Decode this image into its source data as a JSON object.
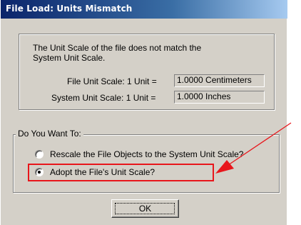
{
  "window": {
    "title": "File Load: Units Mismatch"
  },
  "info": {
    "message_line1": "The Unit Scale of the file does not match the",
    "message_line2": "System Unit Scale.",
    "file_scale_label": "File Unit Scale: 1 Unit =",
    "file_scale_value": "1.0000 Centimeters",
    "system_scale_label": "System Unit Scale: 1 Unit =",
    "system_scale_value": "1.0000 Inches"
  },
  "choice": {
    "legend": "Do You Want To:",
    "options": [
      {
        "label": "Rescale the File Objects to the System Unit Scale?",
        "selected": false
      },
      {
        "label": "Adopt the File's Unit Scale?",
        "selected": true
      }
    ]
  },
  "buttons": {
    "ok_label": "OK"
  },
  "annotation": {
    "color": "#e8161b"
  },
  "colors": {
    "dialog_face": "#d4d0c8",
    "titlebar_start": "#0a246a",
    "titlebar_end": "#a6caf0"
  }
}
